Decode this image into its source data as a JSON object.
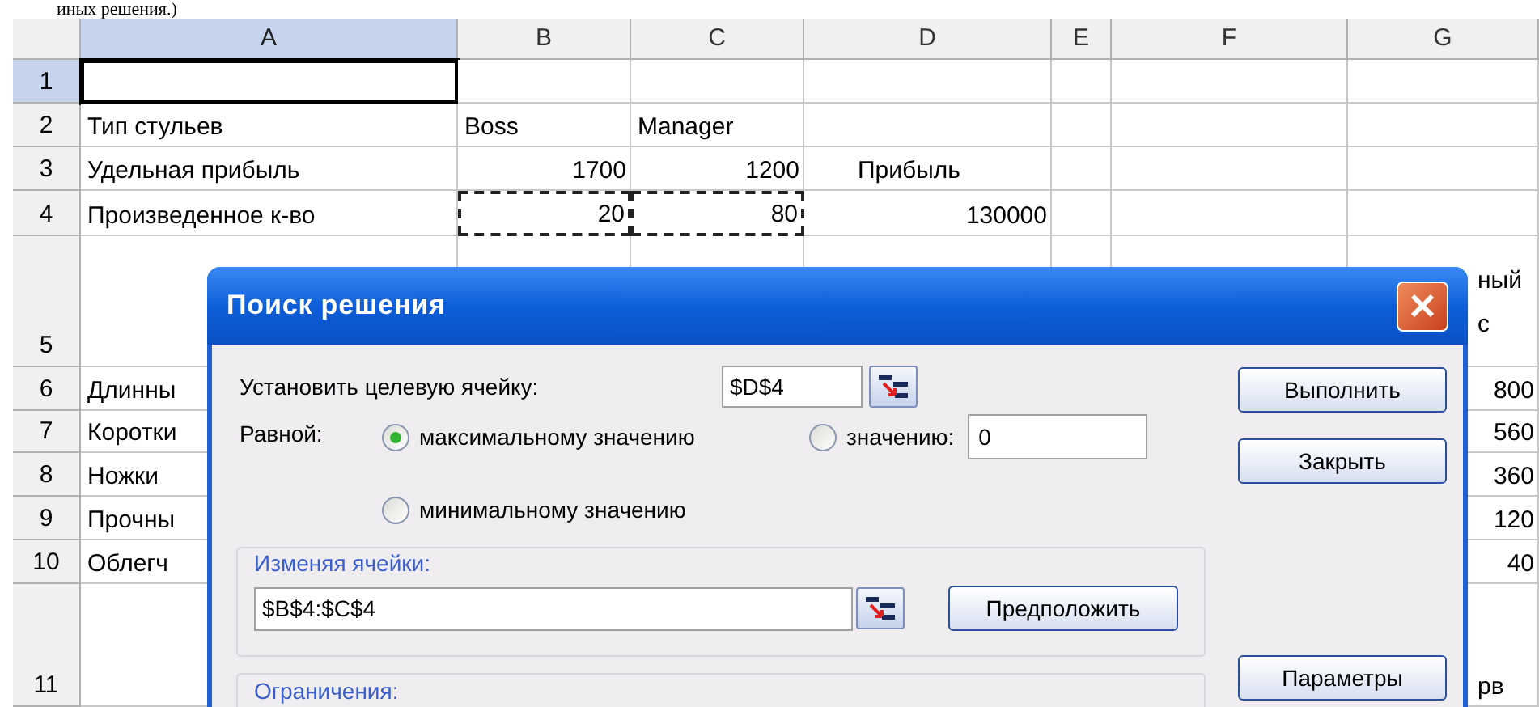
{
  "caption": "иных решения.)",
  "columns": [
    {
      "label": "A",
      "selected": true
    },
    {
      "label": "B",
      "selected": false
    },
    {
      "label": "C",
      "selected": false
    },
    {
      "label": "D",
      "selected": false
    },
    {
      "label": "E",
      "selected": false
    },
    {
      "label": "F",
      "selected": false
    },
    {
      "label": "G",
      "selected": false
    }
  ],
  "rows": [
    {
      "number": "1",
      "selected": true,
      "a": {
        "active": true
      }
    },
    {
      "number": "2",
      "selected": false,
      "a": {
        "text": "Тип стульев",
        "kind": "text"
      },
      "b": {
        "text": "Boss",
        "kind": "text"
      },
      "c": {
        "text": "Manager",
        "kind": "text"
      }
    },
    {
      "number": "3",
      "selected": false,
      "a": {
        "text": "Удельная прибыль",
        "kind": "text"
      },
      "b": {
        "text": "1700",
        "kind": "number"
      },
      "c": {
        "text": "1200",
        "kind": "number"
      },
      "d": {
        "text": "Прибыль",
        "kind": "indented"
      }
    },
    {
      "number": "4",
      "selected": false,
      "a": {
        "text": "Произведенное к-во",
        "kind": "text"
      },
      "b": {
        "text": "20",
        "kind": "number",
        "marquee": true
      },
      "c": {
        "text": "80",
        "kind": "number",
        "marquee": true
      },
      "d": {
        "text": "130000",
        "kind": "number"
      }
    },
    {
      "number": "5",
      "selected": false,
      "g": {
        "text": "ный",
        "kind": "text",
        "second_line": "с"
      }
    },
    {
      "number": "6",
      "selected": false,
      "a": {
        "text": "Длинны",
        "kind": "text"
      },
      "g": {
        "text": "800",
        "kind": "number"
      }
    },
    {
      "number": "7",
      "selected": false,
      "a": {
        "text": "Коротки",
        "kind": "text"
      },
      "g": {
        "text": "560",
        "kind": "number"
      }
    },
    {
      "number": "8",
      "selected": false,
      "a": {
        "text": "Ножки",
        "kind": "text"
      },
      "g": {
        "text": "360",
        "kind": "number"
      }
    },
    {
      "number": "9",
      "selected": false,
      "a": {
        "text": "Прочны",
        "kind": "text"
      },
      "g": {
        "text": "120",
        "kind": "number"
      }
    },
    {
      "number": "10",
      "selected": false,
      "a": {
        "text": "Облегч",
        "kind": "text"
      },
      "g": {
        "text": "40",
        "kind": "number"
      }
    },
    {
      "number": "11",
      "selected": false,
      "g": {
        "text": "рв",
        "kind": "text"
      }
    }
  ],
  "dialog": {
    "title": "Поиск решения",
    "target_label": "Установить целевую ячейку:",
    "target_value": "$D$4",
    "equal_label": "Равной:",
    "options": [
      {
        "label": "максимальному значению",
        "selected": true
      },
      {
        "label": "значению:",
        "selected": false
      },
      {
        "label": "минимальному значению",
        "selected": false
      }
    ],
    "value_field": "0",
    "changing_label": "Изменяя ячейки:",
    "changing_value": "$B$4:$C$4",
    "guess_button": "Предположить",
    "constraints_label": "Ограничения:",
    "buttons": [
      "Выполнить",
      "Закрыть",
      "Параметры"
    ]
  }
}
